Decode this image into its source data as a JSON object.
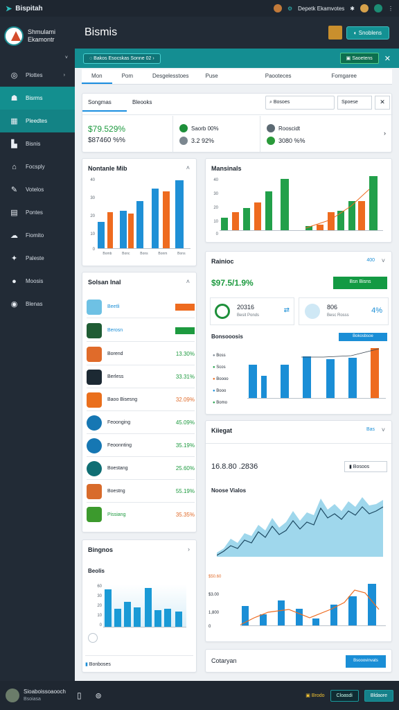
{
  "topbar": {
    "brand": "Bispitah",
    "user_label": "Depetk Ekamvotes"
  },
  "sidebar": {
    "title_line1": "Shmulami",
    "title_line2": "Ekamontr",
    "items": [
      {
        "label": "Plottes",
        "icon": "grid-icon"
      },
      {
        "label": "Bisrms",
        "icon": "home-icon"
      },
      {
        "label": "Pleedtes",
        "icon": "table-icon"
      },
      {
        "label": "Bisnis",
        "icon": "chart-icon"
      },
      {
        "label": "Focsply",
        "icon": "building-icon"
      },
      {
        "label": "Votelos",
        "icon": "pen-icon"
      },
      {
        "label": "Pontes",
        "icon": "doc-icon"
      },
      {
        "label": "Fiomito",
        "icon": "cloud-icon"
      },
      {
        "label": "Paleste",
        "icon": "tool-icon"
      },
      {
        "label": "Moosis",
        "icon": "user-icon"
      },
      {
        "label": "Blenas",
        "icon": "globe-icon"
      }
    ]
  },
  "header": {
    "title": "Bismis",
    "action": "Snoblens"
  },
  "strip": {
    "filter": "Bakos Esocskas Sonne 02",
    "action": "Saoetens"
  },
  "tabs": [
    "Mon",
    "Pom",
    "Desgelesstoes",
    "Puse",
    "Paooteces",
    "Fomgaree"
  ],
  "summary": {
    "title": "Songmas",
    "subtitle": "Bleooks",
    "search": "Bosoes",
    "button": "Spoese",
    "value_main": "$79.529%",
    "value_sub": "$87460 %%",
    "stat1_label": "Saorb 00%",
    "stat1_value": "3.2 92%",
    "stat2_label": "Rooscidt",
    "stat2_value": "3080 %%"
  },
  "chart1": {
    "title": "Nontanle Mib",
    "yticks": [
      "40",
      "30",
      "20",
      "10",
      "0"
    ],
    "xlabels": [
      "Bomb",
      "Bonc",
      "Bons",
      "Bonm",
      "Bons"
    ]
  },
  "chart2": {
    "title": "Mansinals",
    "yticks": [
      "40",
      "30",
      "20",
      "10",
      "0"
    ]
  },
  "kpi": {
    "title": "Rainioc",
    "btn": "400",
    "value": "$97.5/1.9%",
    "action": "Bsn Bisns",
    "t1_value": "20316",
    "t1_label": "Besit Ponds",
    "t2_value": "806",
    "t2_label": "Besc Rosss",
    "t2_pct": "4%",
    "legend_title": "Bonsooosis",
    "legend_action": "Bokosbsoe",
    "legend": [
      "Boss",
      "Scos",
      "Boooo",
      "Booo",
      "Bomo"
    ]
  },
  "listcard": {
    "title": "Solsan Inal",
    "rows": [
      {
        "name": "Beetli",
        "value": "",
        "color": "#6ec1e4"
      },
      {
        "name": "Berosn",
        "value": "",
        "color": "#1f5c34"
      },
      {
        "name": "Borend",
        "value": "13.30%",
        "color": "#e06b2a"
      },
      {
        "name": "Berless",
        "value": "33.31%",
        "color": "#1c2933"
      },
      {
        "name": "Baoo Bisesng",
        "value": "32.09%",
        "color": "#ea6f1c"
      },
      {
        "name": "Feoonging",
        "value": "45.09%",
        "color": "#1677b3"
      },
      {
        "name": "Feoonnting",
        "value": "35.19%",
        "color": "#1677b3"
      },
      {
        "name": "Boestang",
        "value": "25.60%",
        "color": "#0f6e73"
      },
      {
        "name": "Boestng",
        "value": "55.19%",
        "color": "#d86b2b"
      },
      {
        "name": "Pissiang",
        "value": "35.35%",
        "color": "#3c9a2d"
      }
    ]
  },
  "ringing": {
    "title": "Bingnos",
    "sub": "Beolis",
    "footer": "Bonboses",
    "yticks": [
      "60",
      "30",
      "20",
      "10",
      "0"
    ]
  },
  "kipsgat": {
    "title": "Kiiegat",
    "value": "16.8.80 .2836",
    "btn": "Bosoos",
    "area_title": "Noose Vialos",
    "bottom_ticks": [
      "$50.60",
      "$3.00",
      "1,800",
      "0"
    ],
    "action_title": "Cotaryan",
    "action_btn": "Bsooovinvats"
  },
  "footer": {
    "user": "Sioaboissoaooch",
    "sub": "Bsoiasa",
    "b1": "Brodo",
    "b2": "Cloasdi",
    "b3": "Bldaore"
  },
  "colors": {
    "teal": "#138f8f",
    "blue": "#1a8ed6",
    "orange": "#ee6b1f",
    "green": "#22a04a",
    "dark": "#222b36"
  }
}
